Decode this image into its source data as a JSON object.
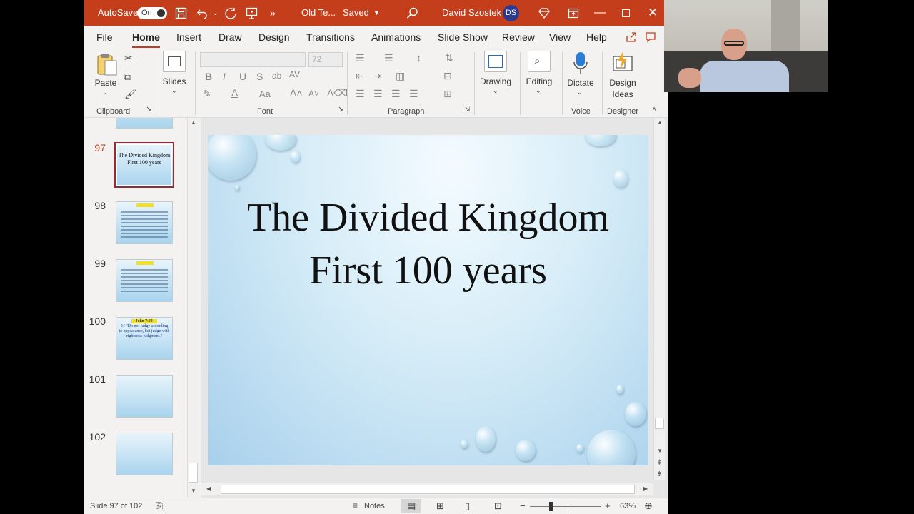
{
  "titlebar": {
    "autosave_label": "AutoSave",
    "autosave_state": "On",
    "more_glyph": "»",
    "doc_title": "Old Te...",
    "save_state": "Saved",
    "user_name": "David Szostek",
    "user_initials": "DS",
    "accent_color": "#c43e1c"
  },
  "menu": {
    "tabs": [
      "File",
      "Home",
      "Insert",
      "Draw",
      "Design",
      "Transitions",
      "Animations",
      "Slide Show",
      "Review",
      "View",
      "Help"
    ],
    "active": "Home"
  },
  "ribbon": {
    "paste": "Paste",
    "slides": "Slides",
    "font_size": "72",
    "drawing": "Drawing",
    "editing": "Editing",
    "dictate": "Dictate",
    "designer_line1": "Design",
    "designer_line2": "Ideas",
    "groups": {
      "clipboard": "Clipboard",
      "font": "Font",
      "paragraph": "Paragraph",
      "voice": "Voice",
      "designer": "Designer"
    },
    "font_buttons": [
      "B",
      "I",
      "U",
      "S",
      "ab",
      "AV"
    ],
    "case_button": "Aa"
  },
  "thumbnails": [
    {
      "number": "97",
      "title_line1": "The Divided Kingdom",
      "title_line2": "First 100 years",
      "selected": true
    },
    {
      "number": "98",
      "selected": false
    },
    {
      "number": "99",
      "selected": false
    },
    {
      "number": "100",
      "heading": "John 7:24",
      "text": "24 \"Do not judge according to appearance, but judge with righteous judgment.\"",
      "selected": false
    },
    {
      "number": "101",
      "selected": false
    },
    {
      "number": "102",
      "selected": false
    }
  ],
  "slide": {
    "title_line1": "The Divided Kingdom",
    "title_line2": "First 100 years"
  },
  "status": {
    "slide_info": "Slide 97 of 102",
    "notes_label": "Notes",
    "zoom_minus": "−",
    "zoom_plus": "+",
    "zoom": "63%"
  }
}
